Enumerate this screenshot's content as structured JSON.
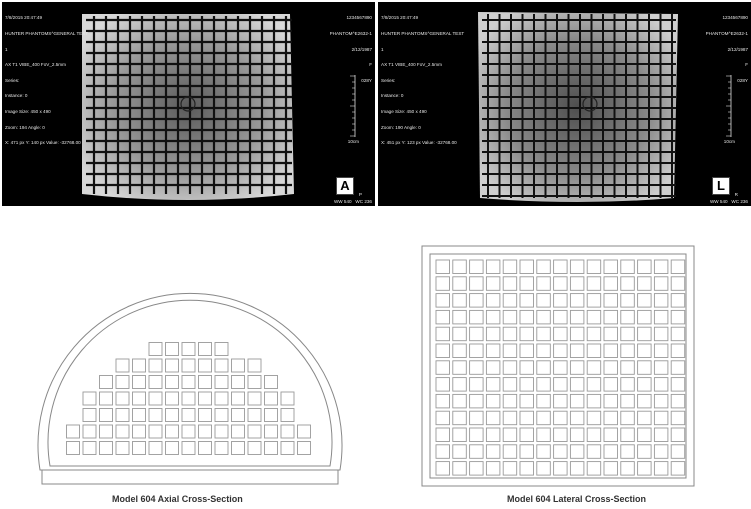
{
  "mri_panels": [
    {
      "id": "axial",
      "top_left": [
        "7/8/2015 20:47:49",
        "HUNTER PHANTOMS^GENERAL TEST",
        "1",
        "AX T1 VIBE_400 FoV_2.5mm",
        "Series:",
        "Instance: 0",
        "Image Size: 450 x 490",
        "Zoom: 194 Angle: 0",
        "X: 471 px Y: 140 px Value: -32768.00"
      ],
      "top_right": [
        "1234567890",
        "PHANTOM^E2632-1",
        "2/12/1987",
        "F",
        "028Y"
      ],
      "scale_label": "10cm",
      "orientation": "A",
      "orientation_side": "P",
      "window": "WW 540   WC 236"
    },
    {
      "id": "lateral",
      "top_left": [
        "7/8/2015 20:47:49",
        "HUNTER PHANTOMS^GENERAL TEST",
        "1",
        "AX T1 VIBE_400 FoV_2.5mm",
        "Series:",
        "Instance: 0",
        "Image Size: 450 x 490",
        "Zoom: 190 Angle: 0",
        "X: 451 px Y: 123 px Value: -32768.00"
      ],
      "top_right": [
        "1234567890",
        "PHANTOM^E2632-1",
        "2/12/1987",
        "F",
        "028Y"
      ],
      "scale_label": "10cm",
      "orientation": "L",
      "orientation_side": "R",
      "window": "WW 540   WC 236"
    }
  ],
  "captions": {
    "axial": "Model 604 Axial Cross-Section",
    "lateral": "Model 604 Lateral Cross-Section"
  },
  "colors": {
    "background": "#ffffff",
    "mri_background": "#000000",
    "line_art": "#777777"
  }
}
